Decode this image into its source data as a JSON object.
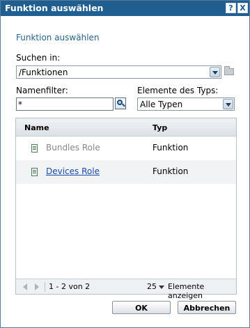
{
  "window": {
    "title": "Funktion auswählen",
    "help_glyph": "?",
    "close_glyph": "X"
  },
  "heading": "Funktion auswählen",
  "search_in": {
    "label": "Suchen in:",
    "value": "/Funktionen"
  },
  "name_filter": {
    "label": "Namenfilter:",
    "value": "*"
  },
  "element_type": {
    "label": "Elemente des Typs:",
    "value": "Alle Typen"
  },
  "table": {
    "columns": [
      "Name",
      "Typ"
    ],
    "rows": [
      {
        "name": "Bundles Role",
        "typ": "Funktion"
      },
      {
        "name": "Devices Role",
        "typ": "Funktion"
      }
    ]
  },
  "pager": {
    "range": "1 - 2 von 2",
    "page_size": "25",
    "show_label": "Elemente anzeigen"
  },
  "buttons": {
    "ok": "OK",
    "cancel": "Abbrechen"
  },
  "colors": {
    "titlebar": "#1f5e8e",
    "link": "#1c4aa8",
    "heading": "#28628e"
  }
}
